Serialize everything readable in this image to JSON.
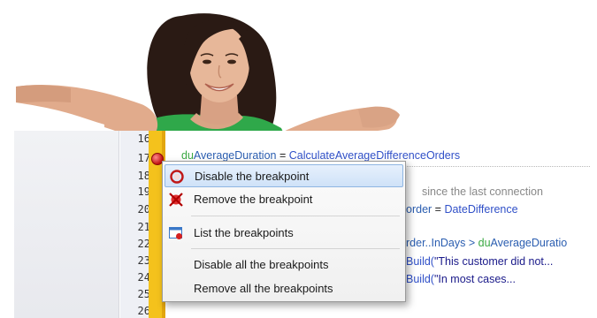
{
  "editor": {
    "line_numbers": [
      "16",
      "17",
      "18",
      "19",
      "20",
      "21",
      "22",
      "23",
      "24",
      "25",
      "26"
    ],
    "code": {
      "line17": {
        "var": "du",
        "id": "AverageDuration",
        "op": " = ",
        "fn": "CalculateAverageDifferenceOrders"
      },
      "line19_comment": "since the last connection",
      "line20_a": "order",
      "line20_op": " = ",
      "line20_fn": "DateDifference",
      "line22_a": "rder..InDays > ",
      "line22_var": "du",
      "line22_id": "AverageDuratio",
      "line23_fn": "Build(",
      "line23_str": "\"This customer did not...",
      "line24_fn": "Build(",
      "line24_str": "\"In most cases..."
    }
  },
  "context_menu": {
    "items": [
      {
        "label": "Disable the breakpoint",
        "icon": "disable-breakpoint-icon",
        "selected": true
      },
      {
        "label": "Remove the breakpoint",
        "icon": "remove-breakpoint-icon"
      },
      {
        "label": "List the breakpoints",
        "icon": "list-breakpoints-icon"
      },
      {
        "label": "Disable all the breakpoints"
      },
      {
        "label": "Remove all the breakpoints"
      }
    ]
  },
  "colors": {
    "breakpoint_margin": "#f4c21c",
    "breakpoint_dot": "#c01010",
    "menu_highlight": "#cfe2f8"
  }
}
